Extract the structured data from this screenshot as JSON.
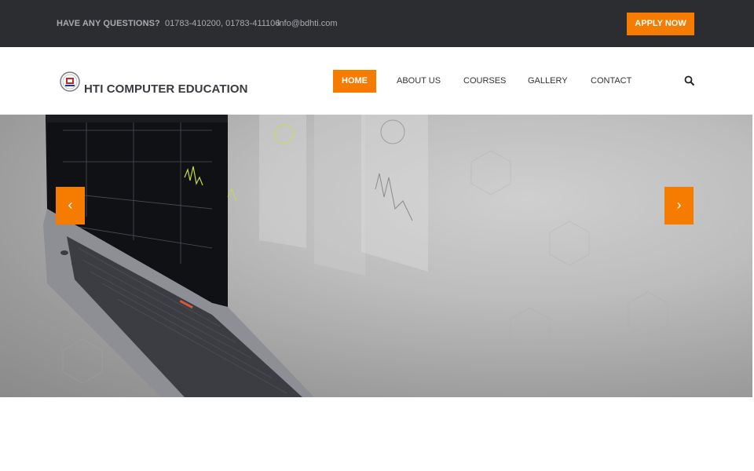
{
  "topbar": {
    "question": "HAVE ANY QUESTIONS?",
    "phones": "01783-410200, 01783-411106",
    "email": "info@bdhti.com",
    "apply_label": "APPLY NOW"
  },
  "header": {
    "brand": "HTI COMPUTER EDUCATION",
    "nav": [
      {
        "label": "HOME"
      },
      {
        "label": "ABOUT US"
      },
      {
        "label": "COURSES"
      },
      {
        "label": "GALLERY"
      },
      {
        "label": "CONTACT"
      }
    ],
    "search_icon": "search-icon"
  },
  "slider": {
    "prev_icon": "‹",
    "next_icon": "›"
  },
  "colors": {
    "accent": "#f57c00",
    "topbar_bg": "#2c2d31",
    "topbar_text": "#a9aab0"
  }
}
